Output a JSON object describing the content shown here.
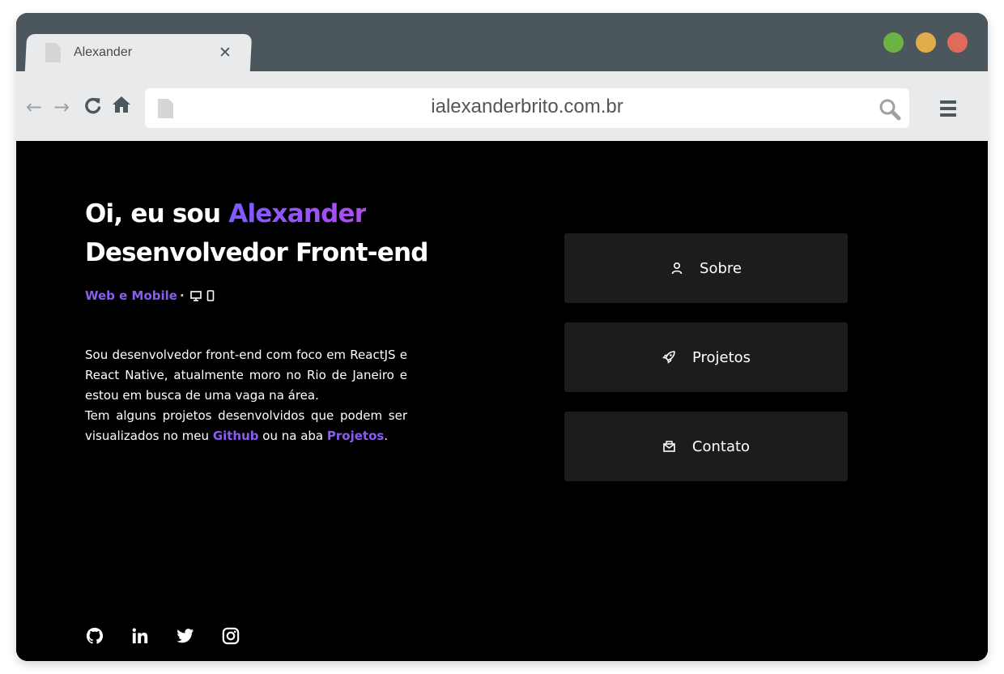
{
  "browser": {
    "tab_title": "Alexander",
    "tab_close": "✕",
    "url": "ialexanderbrito.com.br",
    "traffic_colors": {
      "green": "#6bb443",
      "yellow": "#e3ac4b",
      "red": "#df6b5d"
    },
    "nav": {
      "back": "←",
      "forward": "→",
      "reload": "↻",
      "home": "⌂"
    }
  },
  "hero": {
    "greeting": "Oi, eu sou",
    "name": "Alexander",
    "role": "Desenvolvedor Front-end",
    "platforms": "Web e Mobile",
    "separator": "·",
    "icons": [
      "desktop-icon",
      "mobile-icon"
    ]
  },
  "bio": {
    "p1": "Sou desenvolvedor front-end com foco em ReactJS e React Native, atualmente moro no Rio de Janeiro e estou em busca de uma vaga na área.",
    "p2_start": "Tem alguns projetos desenvolvidos que podem ser visualizados no meu ",
    "github_link": "Github",
    "p2_middle": " ou na aba ",
    "projects_link": "Projetos",
    "p2_end": "."
  },
  "menu": [
    {
      "label": "Sobre",
      "icon": "user-icon"
    },
    {
      "label": "Projetos",
      "icon": "rocket-icon"
    },
    {
      "label": "Contato",
      "icon": "mail-icon"
    }
  ],
  "social": [
    "github-icon",
    "linkedin-icon",
    "twitter-icon",
    "instagram-icon"
  ],
  "colors": {
    "accent": "#8b5cf6",
    "card_bg": "#1c1c1c",
    "page_bg": "#000000"
  }
}
